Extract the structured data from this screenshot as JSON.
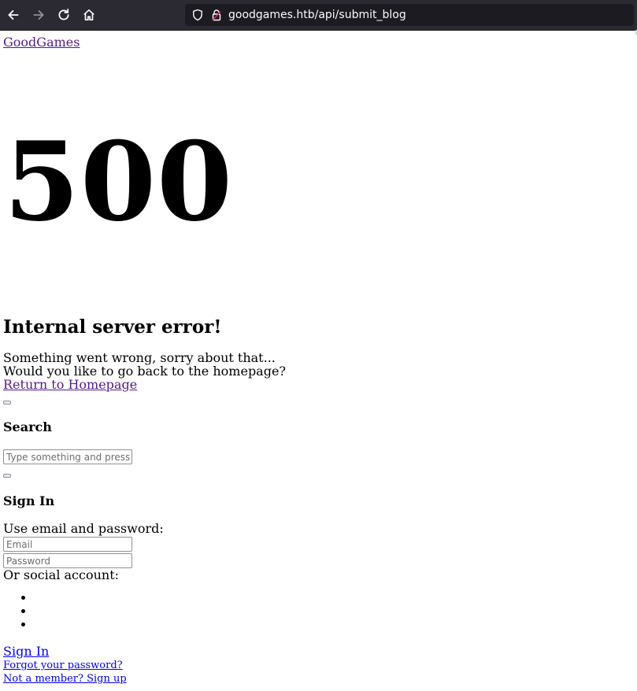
{
  "browser": {
    "url": "goodgames.htb/api/submit_blog",
    "icons": {
      "back": "back-arrow-icon",
      "forward": "forward-arrow-icon",
      "reload": "reload-icon",
      "home": "home-icon",
      "tracking": "shield-icon",
      "connection": "lock-icon"
    },
    "colors": {
      "toolbar": "#2b2a33",
      "urlbar": "#1c1b22",
      "url_text": "#fbfbfe"
    }
  },
  "page": {
    "brand": "GoodGames",
    "error_code": "500",
    "error_title": "Internal server error!",
    "error_message_1": "Something went wrong, sorry about that...",
    "error_message_2": "Would you like to go back to the homepage?",
    "return_link": "Return to Homepage",
    "search": {
      "heading": "Search",
      "placeholder": "Type something and press Enter"
    },
    "signin": {
      "heading": "Sign In",
      "use_email_text": "Use email and password:",
      "email_placeholder": "Email",
      "password_placeholder": "Password",
      "social_text": "Or social account:",
      "submit_link": "Sign In",
      "forgot_link": "Forgot your password?",
      "signup_link": "Not a member? Sign up"
    },
    "colors": {
      "link": "#0000ee",
      "visited_link": "#551a8b"
    }
  }
}
